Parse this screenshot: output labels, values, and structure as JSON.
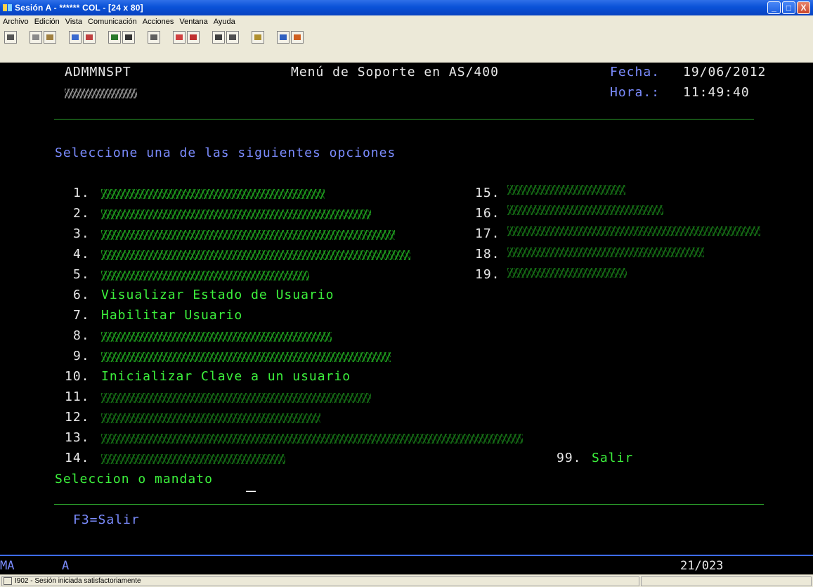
{
  "window": {
    "title": "Sesión A - ****** COL - [24 x 80]",
    "buttons": [
      "_",
      "□",
      "X"
    ]
  },
  "menubar": [
    "Archivo",
    "Edición",
    "Vista",
    "Comunicación",
    "Acciones",
    "Ventana",
    "Ayuda"
  ],
  "toolbar": {
    "icons": [
      "print-screen-icon",
      "copy-icon",
      "paste-icon",
      "send-icon",
      "receive-icon",
      "display-icon",
      "keyboard-icon",
      "macro-icon",
      "record-macro-icon",
      "stop-macro-icon",
      "play-macro-icon",
      "pause-macro-icon",
      "clipboard-icon",
      "color-icon",
      "edit-icon"
    ]
  },
  "screen": {
    "program": "ADMMNSPT",
    "title": "Menú de Soporte en AS/400",
    "fecha_label": "Fecha.",
    "fecha_value": "19/06/2012",
    "hora_label": "Hora.:",
    "hora_value": "11:49:40",
    "prompt": "Seleccione una de las siguientes opciones",
    "options_left": [
      {
        "num": "1.",
        "label": ""
      },
      {
        "num": "2.",
        "label": ""
      },
      {
        "num": "3.",
        "label": ""
      },
      {
        "num": "4.",
        "label": ""
      },
      {
        "num": "5.",
        "label": ""
      },
      {
        "num": "6.",
        "label": "Visualizar Estado de Usuario"
      },
      {
        "num": "7.",
        "label": "Habilitar Usuario"
      },
      {
        "num": "8.",
        "label": ""
      },
      {
        "num": "9.",
        "label": ""
      },
      {
        "num": "10.",
        "label": "Inicializar Clave a un usuario"
      },
      {
        "num": "11.",
        "label": ""
      },
      {
        "num": "12.",
        "label": ""
      },
      {
        "num": "13.",
        "label": ""
      },
      {
        "num": "14.",
        "label": ""
      }
    ],
    "options_right": [
      {
        "num": "15.",
        "label": ""
      },
      {
        "num": "16.",
        "label": ""
      },
      {
        "num": "17.",
        "label": ""
      },
      {
        "num": "18.",
        "label": ""
      },
      {
        "num": "19.",
        "label": ""
      }
    ],
    "exit_num": "99.",
    "exit_label": "Salir",
    "command_label": "Seleccion o mandato",
    "fkey": "F3=Salir"
  },
  "status_line": {
    "mode": "MA",
    "session": "A",
    "position": "21/023"
  },
  "statusbar": {
    "message": "I902 - Sesión iniciada satisfactoriamente"
  }
}
